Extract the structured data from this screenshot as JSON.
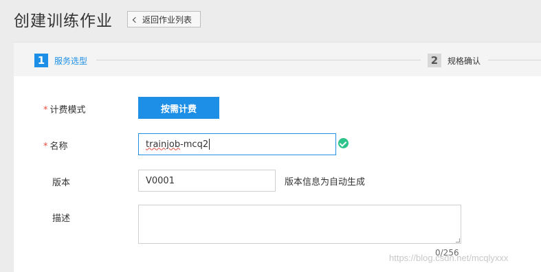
{
  "header": {
    "title": "创建训练作业",
    "back_label": "返回作业列表"
  },
  "steps": [
    {
      "number": "1",
      "label": "服务选型",
      "active": true
    },
    {
      "number": "2",
      "label": "规格确认",
      "active": false
    }
  ],
  "form": {
    "billing": {
      "label": "计费模式",
      "required_mark": "*",
      "value": "按需计费"
    },
    "name": {
      "label": "名称",
      "required_mark": "*",
      "value_part1": "trainjob",
      "value_part2": "-mcq2"
    },
    "version": {
      "label": "版本",
      "value": "V0001",
      "hint": "版本信息为自动生成"
    },
    "description": {
      "label": "描述",
      "counter": "0/256"
    }
  },
  "watermark": "https://blog.csdn.net/mcqlyxxx",
  "colors": {
    "accent": "#1e8fe6",
    "required": "#e74c3c",
    "valid": "#2ec38a"
  }
}
